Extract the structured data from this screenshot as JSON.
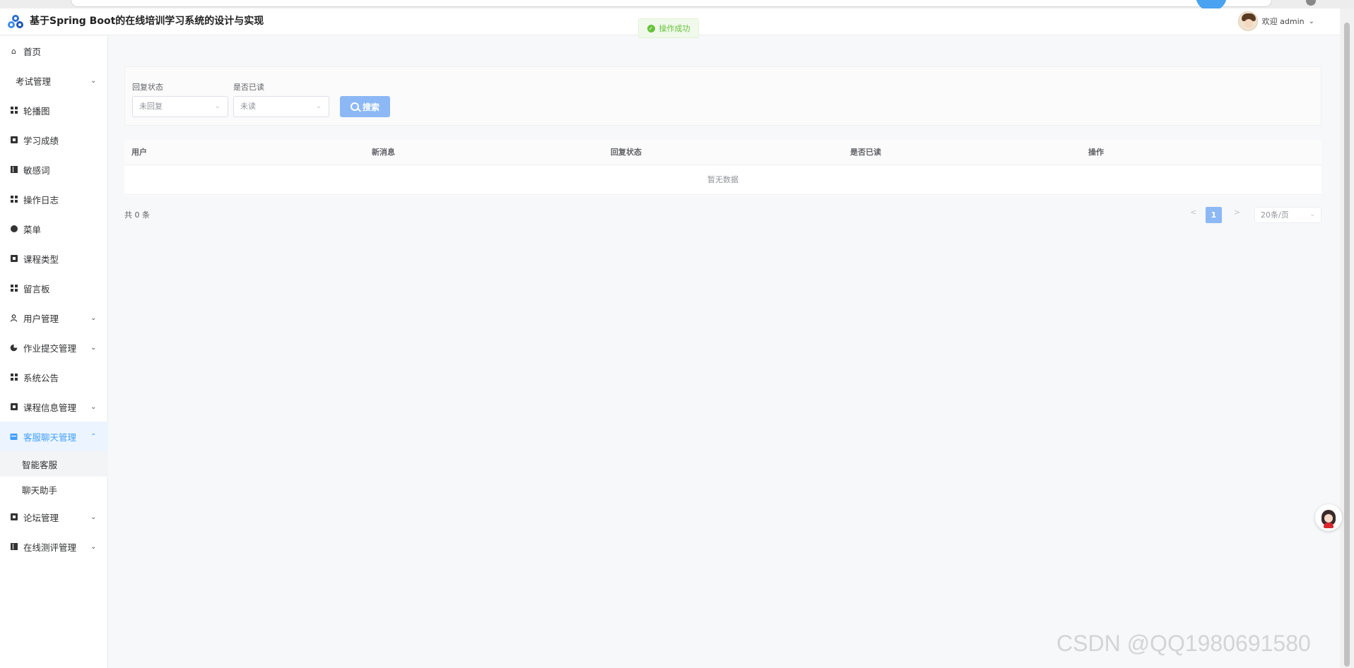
{
  "header": {
    "app_title": "基于Spring Boot的在线培训学习系统的设计与实现",
    "welcome_text": "欢迎 admin"
  },
  "toast": {
    "message": "操作成功"
  },
  "sidebar": {
    "items": [
      {
        "label": "首页",
        "icon": "home-icon",
        "has_arrow": false
      },
      {
        "label": "考试管理",
        "icon": "",
        "has_arrow": true
      },
      {
        "label": "轮播图",
        "icon": "grid-icon",
        "has_arrow": false
      },
      {
        "label": "学习成绩",
        "icon": "square-icon",
        "has_arrow": false
      },
      {
        "label": "敏感词",
        "icon": "bars-icon",
        "has_arrow": false
      },
      {
        "label": "操作日志",
        "icon": "grid-icon",
        "has_arrow": false
      },
      {
        "label": "菜单",
        "icon": "circle-icon",
        "has_arrow": false
      },
      {
        "label": "课程类型",
        "icon": "square-icon",
        "has_arrow": false
      },
      {
        "label": "留言板",
        "icon": "grid-icon",
        "has_arrow": false
      },
      {
        "label": "用户管理",
        "icon": "user-icon",
        "has_arrow": true
      },
      {
        "label": "作业提交管理",
        "icon": "pie-icon",
        "has_arrow": true
      },
      {
        "label": "系统公告",
        "icon": "grid-icon",
        "has_arrow": false
      },
      {
        "label": "课程信息管理",
        "icon": "square-icon",
        "has_arrow": true
      },
      {
        "label": "客服聊天管理",
        "icon": "message-icon",
        "has_arrow": true,
        "expanded": true,
        "active": true
      },
      {
        "label": "论坛管理",
        "icon": "square-icon",
        "has_arrow": true
      },
      {
        "label": "在线测评管理",
        "icon": "bars-icon",
        "has_arrow": true
      }
    ],
    "subitems": [
      {
        "label": "智能客服",
        "active": true
      },
      {
        "label": "聊天助手",
        "active": false
      }
    ]
  },
  "search": {
    "reply_status_label": "回复状态",
    "reply_status_value": "未回复",
    "read_label": "是否已读",
    "read_value": "未读",
    "button_label": "搜索"
  },
  "table": {
    "columns": [
      "用户",
      "新消息",
      "回复状态",
      "是否已读",
      "操作"
    ],
    "empty_text": "暂无数据"
  },
  "pagination": {
    "total_text": "共 0 条",
    "prev": "<",
    "next": ">",
    "current_page": "1",
    "page_size": "20条/页"
  },
  "watermark": "CSDN @QQ1980691580",
  "colors": {
    "accent": "#409eff",
    "button_disabled": "#8cb8f5",
    "success": "#67c23a"
  }
}
